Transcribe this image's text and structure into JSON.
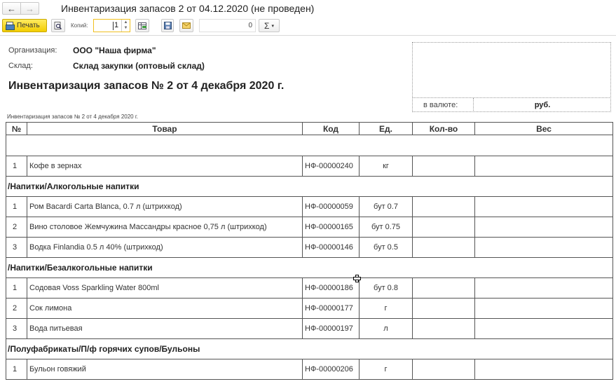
{
  "window": {
    "title": "Инвентаризация запасов 2 от 04.12.2020 (не проведен)",
    "back_label": "←",
    "forward_label": "→"
  },
  "toolbar": {
    "print_label": "Печать",
    "copies_label": "Копий:",
    "copies_value": "1",
    "counter_value": "0",
    "sigma_label": "Σ",
    "dropdown_glyph": "▾"
  },
  "header": {
    "org_label": "Организация:",
    "org_value": "ООО \"Наша фирма\"",
    "warehouse_label": "Склад:",
    "warehouse_value": "Склад закупки (оптовый склад)",
    "doc_title": "Инвентаризация запасов № 2 от 4 декабря 2020 г.",
    "currency_label": "в валюте:",
    "currency_value": "руб.",
    "small_caption": "Инвентаризация запасов № 2 от 4 декабря 2020 г."
  },
  "table": {
    "columns": [
      "№",
      "Товар",
      "Код",
      "Ед.",
      "Кол-во",
      "Вес"
    ],
    "rows": [
      {
        "type": "empty"
      },
      {
        "type": "item",
        "num": "1",
        "name": "Кофе в зернах",
        "code": "НФ-00000240",
        "unit": "кг"
      },
      {
        "type": "group",
        "label": "/Напитки/Алкогольные напитки"
      },
      {
        "type": "item",
        "num": "1",
        "name": "Ром Bacardi Carta Blanca, 0.7 л (штрихкод)",
        "code": "НФ-00000059",
        "unit": "бут 0.7"
      },
      {
        "type": "item",
        "num": "2",
        "name": "Вино столовое Жемчужина Массандры красное 0,75 л (штрихкод)",
        "code": "НФ-00000165",
        "unit": "бут 0.75"
      },
      {
        "type": "item",
        "num": "3",
        "name": "Водка Finlandia 0.5 л 40% (штрихкод)",
        "code": "НФ-00000146",
        "unit": "бут 0.5"
      },
      {
        "type": "group",
        "label": "/Напитки/Безалкогольные напитки"
      },
      {
        "type": "item",
        "num": "1",
        "name": "Содовая Voss Sparkling Water 800ml",
        "code": "НФ-00000186",
        "unit": "бут 0.8"
      },
      {
        "type": "item",
        "num": "2",
        "name": "Сок лимона",
        "code": "НФ-00000177",
        "unit": "г"
      },
      {
        "type": "item",
        "num": "3",
        "name": "Вода питьевая",
        "code": "НФ-00000197",
        "unit": "л"
      },
      {
        "type": "group",
        "label": "/Полуфабрикаты/П/ф горячих супов/Бульоны"
      },
      {
        "type": "item",
        "num": "1",
        "name": "Бульон говяжий",
        "code": "НФ-00000206",
        "unit": "г"
      }
    ]
  }
}
